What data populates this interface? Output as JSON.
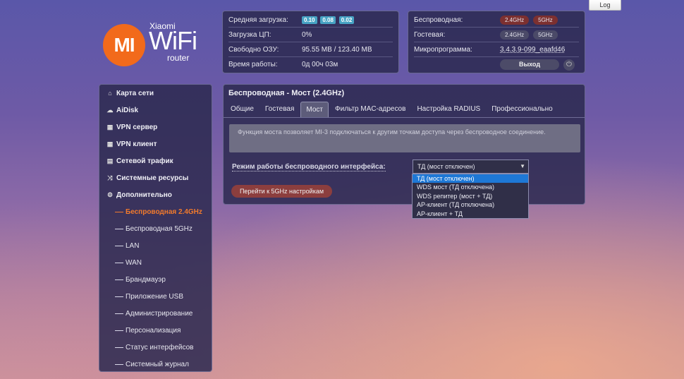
{
  "header": {
    "log_button": "Log",
    "logo": {
      "mark": "MI",
      "brand": "Xiaomi",
      "name": "WiFi",
      "sub": "router"
    }
  },
  "status": {
    "rows": [
      {
        "label": "Средняя загрузка:",
        "badges": [
          "0.10",
          "0.08",
          "0.02"
        ]
      },
      {
        "label": "Загрузка ЦП:",
        "value": "0%"
      },
      {
        "label": "Свободно ОЗУ:",
        "value": "95.55 MB / 123.40 MB"
      },
      {
        "label": "Время работы:",
        "value": "0д 00ч 03м"
      }
    ]
  },
  "info": {
    "wireless_label": "Беспроводная:",
    "guest_label": "Гостевая:",
    "firmware_label": "Микропрограмма:",
    "firmware_value": "3.4.3.9-099_eaafd46",
    "band_24": "2.4GHz",
    "band_5": "5GHz",
    "exit_button": "Выход",
    "colors": {
      "band_active": "#7c3030",
      "band_inactive": "#4b4a68"
    }
  },
  "sidebar": {
    "items": [
      {
        "label": "Карта сети",
        "icon": "home-icon"
      },
      {
        "label": "AiDisk",
        "icon": "cloud-icon"
      },
      {
        "label": "VPN сервер",
        "icon": "vpn-server-icon"
      },
      {
        "label": "VPN клиент",
        "icon": "vpn-client-icon"
      },
      {
        "label": "Сетевой трафик",
        "icon": "traffic-icon"
      },
      {
        "label": "Системные ресурсы",
        "icon": "shuffle-icon"
      },
      {
        "label": "Дополнительно",
        "icon": "gear-icon"
      }
    ],
    "subitems": [
      "Беспроводная 2.4GHz",
      "Беспроводная 5GHz",
      "LAN",
      "WAN",
      "Брандмауэр",
      "Приложение USB",
      "Администрирование",
      "Персонализация",
      "Статус интерфейсов",
      "Системный журнал"
    ],
    "active_color": "#f27a2c"
  },
  "main": {
    "title": "Беспроводная - Мост (2.4GHz)",
    "tabs": [
      "Общие",
      "Гостевая",
      "Мост",
      "Фильтр MAC-адресов",
      "Настройка RADIUS",
      "Профессионально"
    ],
    "notice": "Функция моста позволяет MI-3 подключаться к другим точкам доступа через беспроводное соединение.",
    "mode_label": "Режим работы беспроводного интерфейса:",
    "mode_selected": "ТД (мост отключен)",
    "mode_options": [
      "ТД (мост отключен)",
      "WDS мост (ТД отключена)",
      "WDS репитер (мост + ТД)",
      "AP-клиент (ТД отключена)",
      "AP-клиент + ТД"
    ],
    "go_5ghz_button": "Перейти к 5GHz настройкам",
    "colors": {
      "option_highlight": "#1e78d6",
      "button": "#8c3e3e"
    }
  }
}
